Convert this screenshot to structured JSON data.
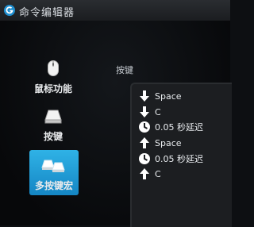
{
  "window": {
    "title": "命令编辑器"
  },
  "sidebar": {
    "items": [
      {
        "label": "鼠标功能",
        "icon": "mouse-icon",
        "selected": false
      },
      {
        "label": "按键",
        "icon": "key-icon",
        "selected": false
      },
      {
        "label": "多按键宏",
        "icon": "multi-key-icon",
        "selected": true
      }
    ]
  },
  "editor": {
    "section_label": "按键",
    "events": [
      {
        "icon": "arrow-down-icon",
        "text": "Space"
      },
      {
        "icon": "arrow-down-icon",
        "text": "C"
      },
      {
        "icon": "clock-icon",
        "text": "0.05 秒延迟"
      },
      {
        "icon": "arrow-up-icon",
        "text": "Space"
      },
      {
        "icon": "clock-icon",
        "text": "0.05 秒延迟"
      },
      {
        "icon": "arrow-up-icon",
        "text": "C"
      }
    ]
  },
  "colors": {
    "accent": "#1e9bd7",
    "background": "#0d0f12",
    "panel": "#1c1e21"
  }
}
